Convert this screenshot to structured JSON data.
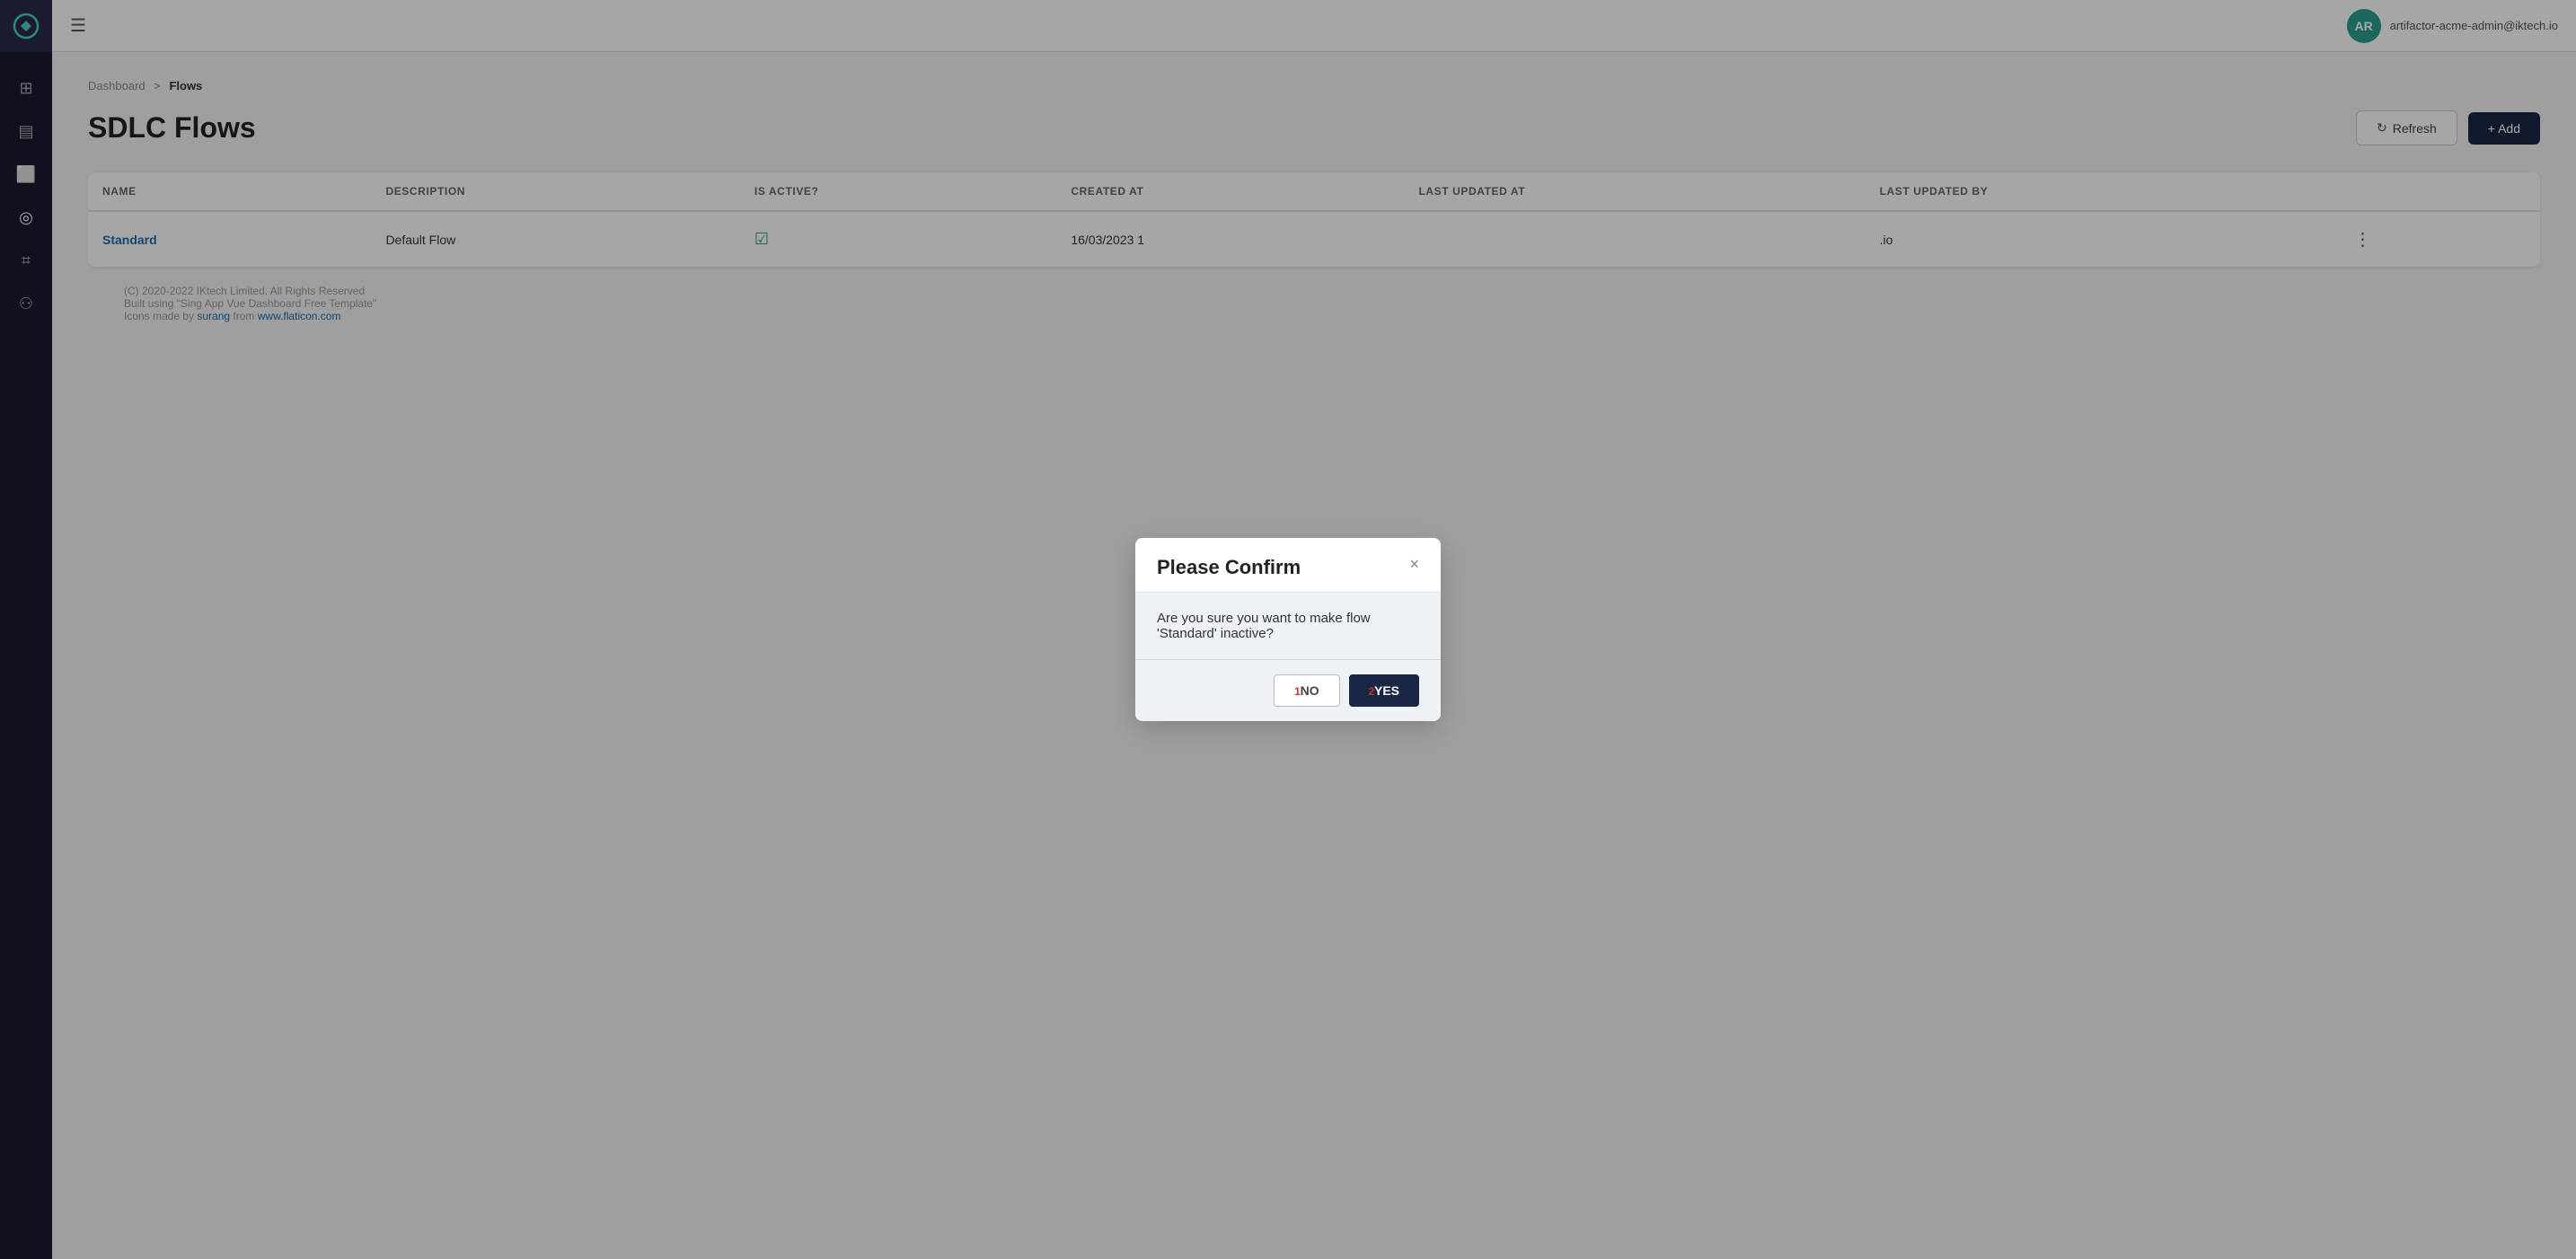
{
  "sidebar": {
    "logo_alt": "App Logo",
    "icons": [
      {
        "name": "grid-icon",
        "symbol": "⊞"
      },
      {
        "name": "chart-icon",
        "symbol": "📊"
      },
      {
        "name": "calendar-icon",
        "symbol": "📅"
      },
      {
        "name": "globe-icon",
        "symbol": "🌐"
      },
      {
        "name": "tag-icon",
        "symbol": "🏷"
      },
      {
        "name": "users-icon",
        "symbol": "👥"
      }
    ]
  },
  "header": {
    "hamburger_label": "☰",
    "avatar_initials": "AR",
    "user_email": "artifactor-acme-admin@iktech.io"
  },
  "breadcrumb": {
    "parent": "Dashboard",
    "separator": ">",
    "current": "Flows"
  },
  "page": {
    "title": "SDLC Flows",
    "refresh_label": "Refresh",
    "add_label": "+ Add"
  },
  "table": {
    "columns": [
      "NAME",
      "DESCRIPTION",
      "IS ACTIVE?",
      "CREATED AT",
      "LAST UPDATED AT",
      "LAST UPDATED BY"
    ],
    "rows": [
      {
        "name": "Standard",
        "description": "Default Flow",
        "is_active": true,
        "created_at": "16/03/2023 1",
        "last_updated_at": "",
        "last_updated_by": ".io"
      }
    ]
  },
  "modal": {
    "title": "Please Confirm",
    "body": "Are you sure you want to make flow 'Standard' inactive?",
    "no_label": "NO",
    "yes_label": "YES",
    "no_badge": "1",
    "yes_badge": "2"
  },
  "footer": {
    "copyright": "(C) 2020-2022 IKtech Limited. All Rights Reserved",
    "built_with": "Built using \"Sing App Vue Dashboard Free Template\"",
    "icons_credit_prefix": "Icons made by ",
    "icons_credit_author": "surang",
    "icons_credit_middle": " from ",
    "icons_credit_site": "www.flaticon.com"
  }
}
